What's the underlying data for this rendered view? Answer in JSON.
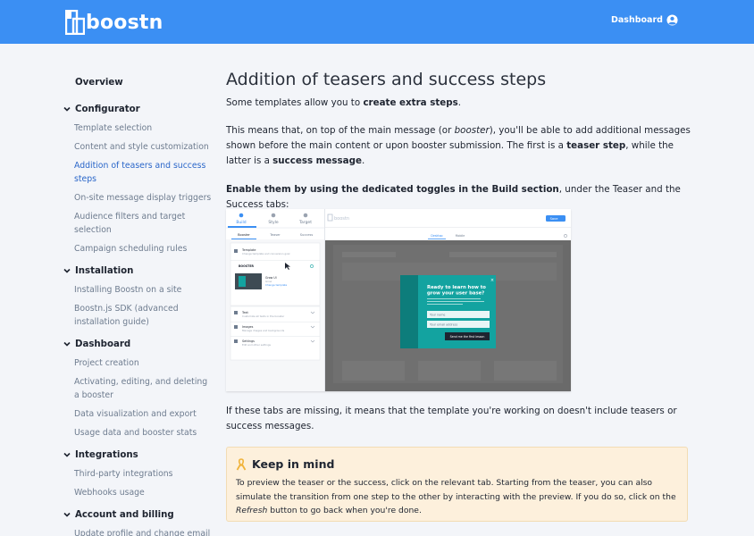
{
  "header": {
    "brand": "boostn",
    "nav_dashboard": "Dashboard",
    "accent": "#3b8ff3"
  },
  "sidebar": {
    "overview": "Overview",
    "sections": [
      {
        "title": "Configurator",
        "items": [
          "Template selection",
          "Content and style customization",
          "Addition of teasers and success steps",
          "On-site message display triggers",
          "Audience filters and target selection",
          "Campaign scheduling rules"
        ]
      },
      {
        "title": "Installation",
        "items": [
          "Installing Boostn on a site",
          "Boostn.js SDK (advanced installation guide)"
        ]
      },
      {
        "title": "Dashboard",
        "items": [
          "Project creation",
          "Activating, editing, and deleting a booster",
          "Data visualization and export",
          "Usage data and booster stats"
        ]
      },
      {
        "title": "Integrations",
        "items": [
          "Third-party integrations",
          "Webhooks usage"
        ]
      },
      {
        "title": "Account and billing",
        "items": [
          "Update profile and change email"
        ]
      }
    ]
  },
  "article": {
    "title": "Addition of teasers and success steps",
    "p1_a": "Some templates allow you to ",
    "p1_b": "create extra steps",
    "p1_c": ".",
    "p2_a": "This means that, on top of the main message (or ",
    "p2_b": "booster",
    "p2_c": "), you'll be able to add additional messages shown before the main content or upon booster submission. The first is a ",
    "p2_d": "teaser step",
    "p2_e": ", while the latter is a ",
    "p2_f": "success message",
    "p2_g": ".",
    "p3_a": "Enable them by using the dedicated toggles in the Build section",
    "p3_b": ", under the Teaser and the Success tabs:",
    "p4": "If these tabs are missing, it means that the template you're working on doesn't include teasers or success messages."
  },
  "screenshot": {
    "tabs": [
      "Build",
      "Style",
      "Target"
    ],
    "subtabs": [
      "Booster",
      "Teaser",
      "Success"
    ],
    "brand": "boostn",
    "save": "Save",
    "view_desktop": "Desktop",
    "view_mobile": "Mobile",
    "panel_template": "Template",
    "panel_template_sub": "Change template and conversion goal",
    "panel_booster": "BOOSTER",
    "card_title": "Grow UI",
    "card_sub": "Grow",
    "card_link": "Change template",
    "rows": [
      {
        "title": "Text",
        "sub": "Customize all texts in the booster"
      },
      {
        "title": "Images",
        "sub": "Manage images and backgrounds"
      },
      {
        "title": "Settings",
        "sub": "Edit and other settings"
      }
    ],
    "popup_title": "Ready to learn how to grow your user base?",
    "popup_desc": "Get our free 7-email crash course and discover some of the most effective growth marketing techniques.",
    "field_name": "Your name",
    "field_email": "Your email address",
    "cta": "Send me the first lesson",
    "teal": "#13a3a0"
  },
  "callout": {
    "title": "Keep in mind",
    "b1": "To preview the teaser or the success, click on the relevant tab. Starting from the teaser, you can also simulate the transition from one step to the other by interacting with the preview. If you do so, click on the ",
    "b2": "Refresh",
    "b3": " button to go back when you're done."
  }
}
